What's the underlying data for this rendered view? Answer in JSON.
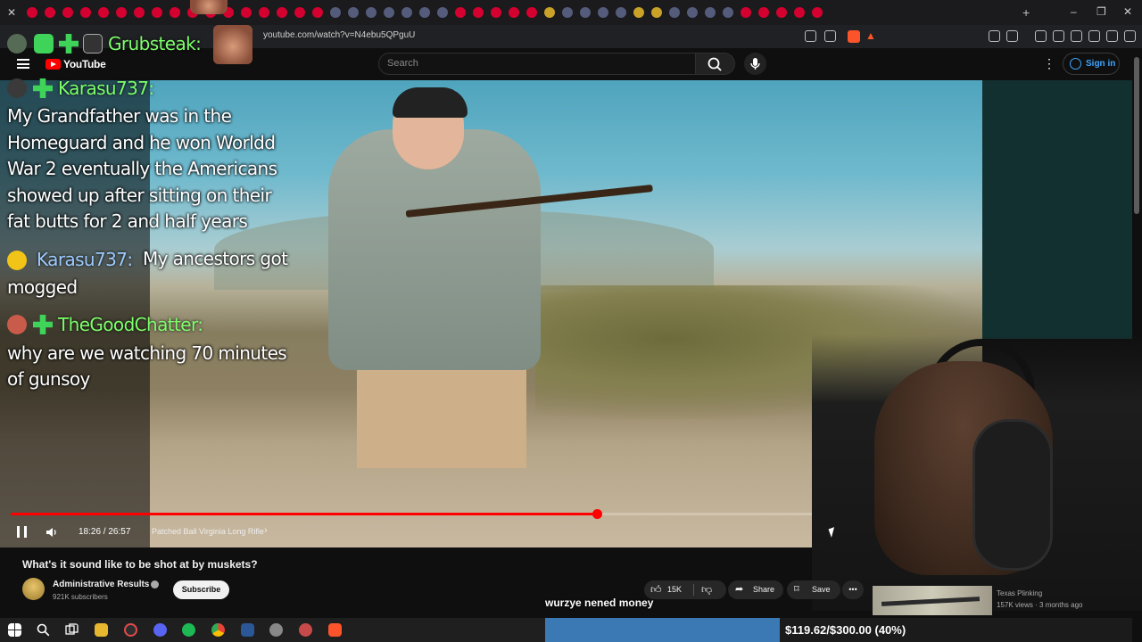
{
  "browser": {
    "url": "youtube.com/watch?v=N4ebu5QPguU"
  },
  "youtube": {
    "logo_text": "YouTube",
    "search_placeholder": "Search",
    "sign_in_label": "Sign in",
    "player": {
      "time": "18:26 / 26:57",
      "chapter": "Patched Ball Virginia Long Rifle",
      "progress_fraction": 0.684,
      "progress_color": "#ff0000"
    },
    "video_title": "What's it sound like to be shot at by muskets?",
    "channel_name": "Administrative Results",
    "subscribers": "921K subscribers",
    "subscribe_label": "Subscribe",
    "likes": "15K",
    "share_label": "Share",
    "save_label": "Save",
    "recommended": {
      "channel": "Texas Plinking",
      "meta": "157K views · 3 months ago"
    }
  },
  "stream_overlay": {
    "chat": [
      {
        "user": "Grubsteak:",
        "message": ""
      },
      {
        "user": "Karasu737:",
        "message_lines": [
          "My Grandfather was in the",
          "Homeguard and he won Worldd",
          "War 2 eventually the Americans",
          "showed up after sitting on their",
          "fat butts for 2 and half years"
        ]
      },
      {
        "user": "Karasu737:",
        "message_lines": [
          "My ancestors got",
          "mogged"
        ]
      },
      {
        "user": "TheGoodChatter:",
        "message_lines": [
          "why are we watching 70 minutes",
          "of gunsoy"
        ]
      }
    ],
    "tts_text": "wurzye nened money",
    "goal": {
      "text": "$119.62/$300.00 (40%)",
      "fraction": 0.4,
      "color": "#3b79b4"
    }
  }
}
